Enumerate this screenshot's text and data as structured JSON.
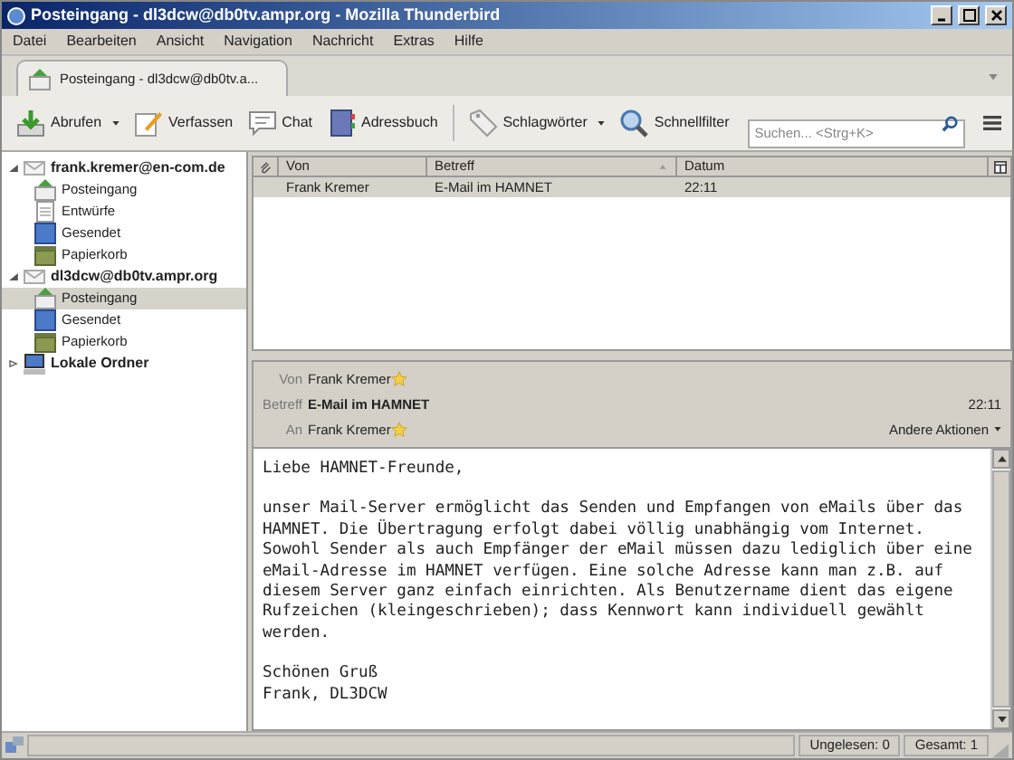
{
  "window": {
    "title": "Posteingang - dl3dcw@db0tv.ampr.org - Mozilla Thunderbird"
  },
  "menu": [
    "Datei",
    "Bearbeiten",
    "Ansicht",
    "Navigation",
    "Nachricht",
    "Extras",
    "Hilfe"
  ],
  "tabs": [
    {
      "label": "Posteingang - dl3dcw@db0tv.a...",
      "selected": true
    }
  ],
  "toolbar": [
    {
      "kind": "get",
      "label": "Abrufen",
      "dropdown": true
    },
    {
      "kind": "compose",
      "label": "Verfassen",
      "dropdown": false
    },
    {
      "kind": "chat",
      "label": "Chat",
      "dropdown": false
    },
    {
      "kind": "book",
      "label": "Adressbuch",
      "dropdown": false
    },
    {
      "kind": "tag",
      "label": "Schlagwörter",
      "dropdown": true
    },
    {
      "kind": "filter",
      "label": "Schnellfilter",
      "dropdown": false
    }
  ],
  "search": {
    "placeholder": "Suchen... <Strg+K>"
  },
  "sidebar": {
    "items": [
      {
        "label": "frank.kremer@en-com.de",
        "kind": "account",
        "expanded": true,
        "selected": false,
        "children": [
          {
            "label": "Posteingang",
            "kind": "inbox",
            "selected": false
          },
          {
            "label": "Entwürfe",
            "kind": "drafts",
            "selected": false
          },
          {
            "label": "Gesendet",
            "kind": "sent",
            "selected": false
          },
          {
            "label": "Papierkorb",
            "kind": "trash",
            "selected": false
          }
        ]
      },
      {
        "label": "dl3dcw@db0tv.ampr.org",
        "kind": "account",
        "expanded": true,
        "selected": false,
        "children": [
          {
            "label": "Posteingang",
            "kind": "inbox",
            "selected": true
          },
          {
            "label": "Gesendet",
            "kind": "sent",
            "selected": false
          },
          {
            "label": "Papierkorb",
            "kind": "trash",
            "selected": false
          }
        ]
      },
      {
        "label": "Lokale Ordner",
        "kind": "local",
        "expanded": false,
        "selected": false
      }
    ]
  },
  "table": {
    "columns": [
      "Von",
      "Betreff",
      "Datum"
    ],
    "rows": [
      {
        "cells": [
          "Frank Kremer",
          "E-Mail im HAMNET",
          "22:11"
        ],
        "selected": true
      }
    ]
  },
  "message": {
    "fields": [
      {
        "label": "Von",
        "value": "Frank Kremer",
        "kind": "contact"
      },
      {
        "label": "Betreff",
        "value": "E-Mail im HAMNET",
        "kind": "subject",
        "time": "22:11"
      },
      {
        "label": "An",
        "value": "Frank Kremer",
        "kind": "contact",
        "action": "Andere Aktionen"
      }
    ],
    "body": [
      [
        "Liebe HAMNET-Freunde,"
      ],
      [
        "unser Mail-Server ermöglicht das Senden und Empfangen von eMails über das",
        "HAMNET. Die Übertragung erfolgt dabei völlig unabhängig vom Internet.",
        "Sowohl Sender als auch Empfänger der eMail müssen dazu lediglich über eine",
        "eMail-Adresse im HAMNET verfügen. Eine solche Adresse kann man z.B. auf",
        "diesem Server ganz einfach einrichten. Als Benutzername dient das eigene",
        "Rufzeichen (kleingeschrieben); dass Kennwort kann individuell gewählt",
        "werden."
      ],
      [
        "Schönen Gruß",
        "Frank, DL3DCW"
      ]
    ]
  },
  "status_bar": {
    "unread": "Ungelesen: 0",
    "total": "Gesamt: 1"
  }
}
